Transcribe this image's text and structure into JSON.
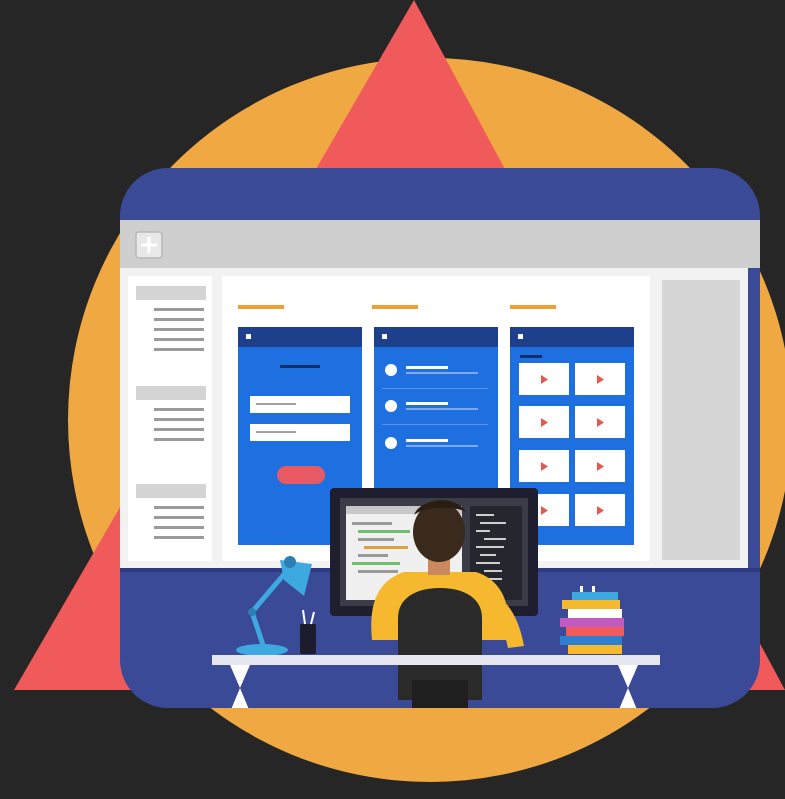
{
  "colors": {
    "background": "#262626",
    "circle": "#F0A942",
    "triangle": "#F05A5A",
    "frame": "#3A4A97",
    "browser_bar": "#CFCFCF",
    "canvas": "#FFFFFF",
    "sidebar_block": "#D4D4D4",
    "panel_blue": "#1E6FE0",
    "panel_header": "#1E3F8A",
    "accent_orange": "#F0A030",
    "form_button": "#E85A63",
    "person_shirt": "#F5B82E",
    "person_hair": "#3A2A1E",
    "chair": "#2A2A2A",
    "desk": "#E6E6F0",
    "lamp": "#3EA8E0"
  },
  "icons": {
    "add_tab": "plus-icon",
    "video_tile": "play-icon"
  }
}
